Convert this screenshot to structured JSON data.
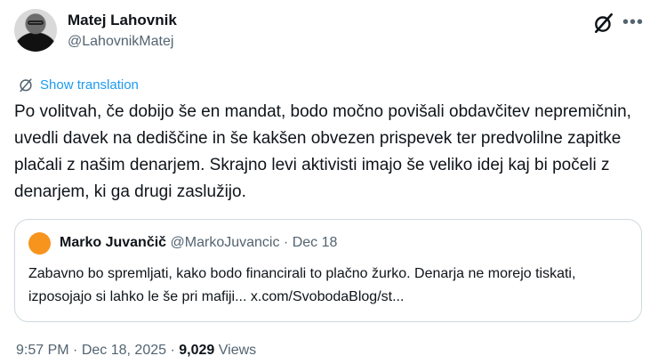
{
  "author": {
    "name": "Matej Lahovnik",
    "handle": "@LahovnikMatej"
  },
  "translate_label": "Show translation",
  "tweet_text": "Po volitvah, če dobijo še en mandat, bodo močno povišali obdavčitev nepremičnin, uvedli davek na dediščine in še kakšen obvezen prispevek ter predvolilne zapitke plačali z našim denarjem. Skrajno levi aktivisti imajo še veliko idej kaj bi počeli z denarjem, ki ga drugi zaslužijo.",
  "quote": {
    "name": "Marko Juvančič",
    "handle": "@MarkoJuvancic",
    "separator": "·",
    "date": "Dec 18",
    "text": "Zabavno bo spremljati, kako bodo financirali to plačno žurko. Denarja ne morejo tiskati, izposojajo si lahko le še pri mafiji... x.com/SvobodaBlog/st..."
  },
  "meta": {
    "time": "9:57 PM",
    "sep1": "·",
    "date": "Dec 18, 2025",
    "sep2": "·",
    "views_count": "9,029",
    "views_label": "Views"
  },
  "icons": {
    "grok": "grok-icon",
    "more": "more-icon",
    "translate": "translate-icon"
  },
  "colors": {
    "accent": "#1d9bf0",
    "secondary_text": "#536471",
    "border": "#cfd9de",
    "quote_avatar": "#f7941d"
  }
}
